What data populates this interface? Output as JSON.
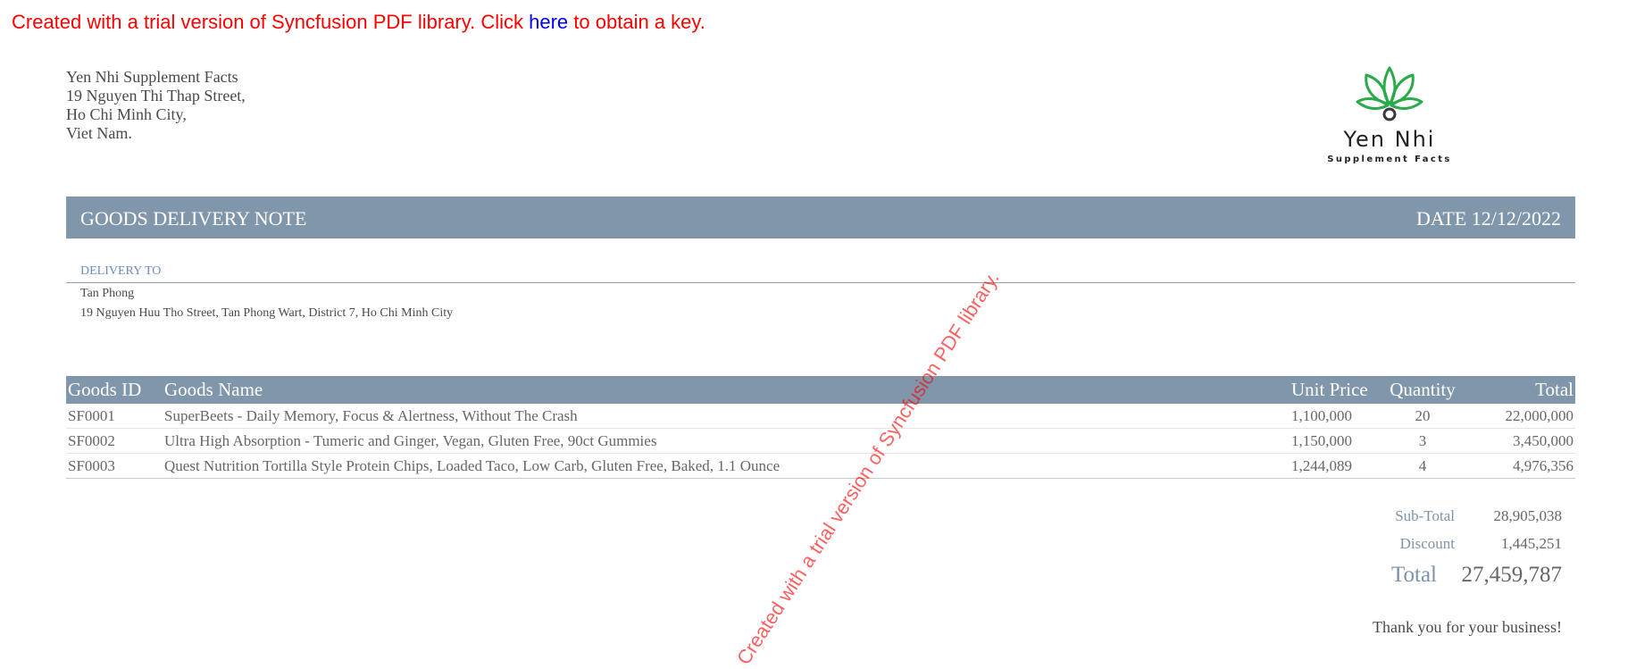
{
  "trial_notice": {
    "prefix": "Created with a trial version of Syncfusion PDF library. Click ",
    "link": "here",
    "suffix": " to obtain a key."
  },
  "company": {
    "address_lines": [
      "Yen Nhi Supplement Facts",
      "19 Nguyen Thi Thap Street,",
      "Ho Chi Minh City,",
      "Viet Nam."
    ],
    "logo_name": "Yen Nhi",
    "logo_tagline": "Supplement Facts",
    "logo_color": "#2aaa4a"
  },
  "document": {
    "title": "GOODS DELIVERY NOTE",
    "date": "DATE 12/12/2022",
    "header_color": "#8096ab"
  },
  "delivery": {
    "label": "DELIVERY TO",
    "name": "Tan Phong",
    "address": "19 Nguyen Huu Tho Street, Tan Phong Wart, District 7, Ho Chi Minh City"
  },
  "table": {
    "columns": [
      "Goods ID",
      "Goods Name",
      "Unit Price",
      "Quantity",
      "Total"
    ],
    "rows": [
      [
        "SF0001",
        "SuperBeets - Daily Memory, Focus & Alertness, Without The Crash",
        "1,100,000",
        "20",
        "22,000,000"
      ],
      [
        "SF0002",
        "Ultra High Absorption - Tumeric and Ginger, Vegan, Gluten Free, 90ct Gummies",
        "1,150,000",
        "3",
        "3,450,000"
      ],
      [
        "SF0003",
        "Quest Nutrition Tortilla Style Protein Chips, Loaded Taco, Low Carb, Gluten Free, Baked, 1.1 Ounce",
        "1,244,089",
        "4",
        "4,976,356"
      ]
    ]
  },
  "summary": {
    "subtotal_label": "Sub-Total",
    "subtotal": "28,905,038",
    "discount_label": "Discount",
    "discount": "1,445,251",
    "total_label": "Total",
    "total": "27,459,787"
  },
  "thanks": "Thank you for your business!",
  "watermark": "Created with a trial version of Syncfusion PDF library."
}
